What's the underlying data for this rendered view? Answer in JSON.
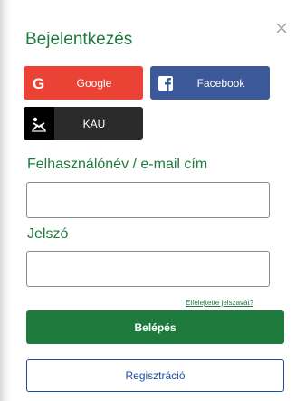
{
  "dialog": {
    "title": "Bejelentkezés"
  },
  "social": {
    "google_label": "Google",
    "facebook_label": "Facebook",
    "kau_label": "KAÜ"
  },
  "form": {
    "username_label": "Felhasználónév / e-mail cím",
    "username_value": "",
    "password_label": "Jelszó",
    "password_value": "",
    "forgot_link": "Elfelejtette jelszavát?",
    "login_button": "Belépés",
    "register_button": "Regisztráció"
  },
  "colors": {
    "brand_green": "#1f7a3d",
    "google_red": "#ea4335",
    "facebook_blue": "#3b5998",
    "kau_dark": "#2b2b2b",
    "register_blue": "#1a4fa0"
  }
}
